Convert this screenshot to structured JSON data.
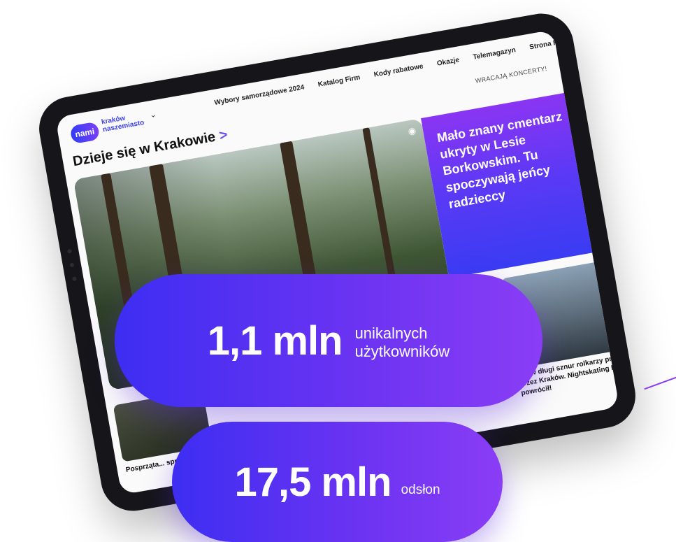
{
  "site": {
    "logo_badge": "nami",
    "logo_line1": "kraków",
    "logo_line2": "naszemiasto"
  },
  "nav": {
    "items": [
      "Wybory samorządowe 2024",
      "Katalog Firm",
      "Kody rabatowe",
      "Okazje",
      "Telemagazyn",
      "Strona Kobiet"
    ],
    "ticker": "WRACAJĄ KONCERTY!"
  },
  "section": {
    "title": "Dzieje się w Krakowie",
    "arrow": ">"
  },
  "featured": {
    "headline": "Mało znany cmentarz ukryty w Lesie Borkowskim. Tu spoczywają jeńcy radzieccy"
  },
  "cards": {
    "right_caption": "Znów długi sznur rolkarzy przejechał przez Kraków. Nightskating Kraków powrócił!",
    "left_caption": "Posprząta... sprzed..."
  },
  "stats": {
    "users_value": "1,1 mln",
    "users_label_line1": "unikalnych",
    "users_label_line2": "użytkowników",
    "views_value": "17,5 mln",
    "views_label": "odsłon"
  },
  "icons": {
    "camera": "camera-icon",
    "chevron": "chevron-down-icon",
    "arrow": "chevron-right-icon"
  },
  "colors": {
    "accent_start": "#3d2ef2",
    "accent_end": "#8a3df5"
  }
}
